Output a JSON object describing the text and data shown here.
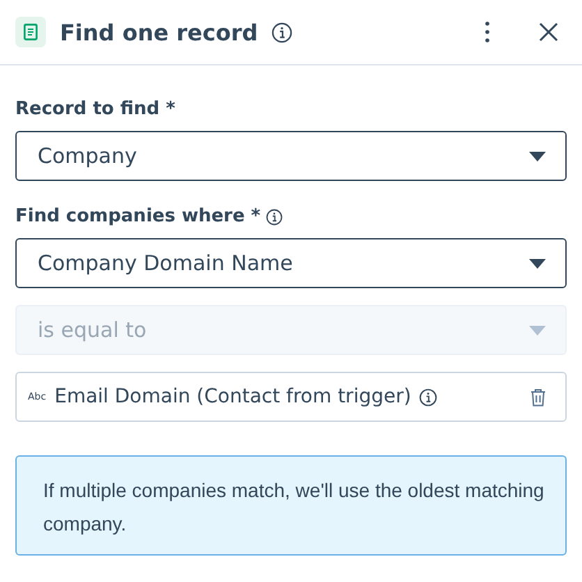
{
  "header": {
    "title": "Find one record"
  },
  "record_field": {
    "label": "Record to find *",
    "value": "Company"
  },
  "criteria": {
    "label": "Find companies where *",
    "property": {
      "value": "Company Domain Name",
      "disabled": false
    },
    "operator": {
      "value": "is equal to",
      "disabled": true
    },
    "token": {
      "type_badge": "Abc",
      "value": "Email Domain (Contact from trigger)"
    }
  },
  "notice": "If multiple companies match, we'll use the oldest matching company."
}
